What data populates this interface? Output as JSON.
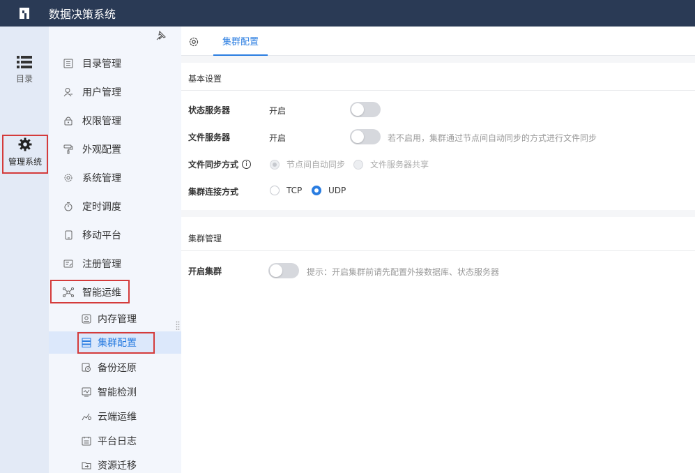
{
  "app": {
    "title": "数据决策系统"
  },
  "rail": {
    "directory_label": "目录",
    "admin_label": "管理系统"
  },
  "menu": {
    "items": [
      {
        "label": "目录管理",
        "icon": "list-doc-icon"
      },
      {
        "label": "用户管理",
        "icon": "user-icon"
      },
      {
        "label": "权限管理",
        "icon": "lock-icon"
      },
      {
        "label": "外观配置",
        "icon": "paint-roller-icon"
      },
      {
        "label": "系统管理",
        "icon": "gear-icon"
      },
      {
        "label": "定时调度",
        "icon": "stopwatch-icon"
      },
      {
        "label": "移动平台",
        "icon": "mobile-icon"
      },
      {
        "label": "注册管理",
        "icon": "register-icon"
      },
      {
        "label": "智能运维",
        "icon": "network-icon"
      }
    ],
    "sub_items": [
      {
        "label": "内存管理",
        "icon": "memory-icon"
      },
      {
        "label": "集群配置",
        "icon": "cluster-icon"
      },
      {
        "label": "备份还原",
        "icon": "backup-icon"
      },
      {
        "label": "智能检测",
        "icon": "monitor-icon"
      },
      {
        "label": "云端运维",
        "icon": "cloud-chart-icon"
      },
      {
        "label": "平台日志",
        "icon": "log-icon"
      },
      {
        "label": "资源迁移",
        "icon": "migrate-icon"
      }
    ],
    "active": "集群配置"
  },
  "tabs": {
    "active_label": "集群配置"
  },
  "basic": {
    "title": "基本设置",
    "state_server": {
      "label": "状态服务器",
      "value": "开启",
      "enabled": false
    },
    "file_server": {
      "label": "文件服务器",
      "value": "开启",
      "enabled": false,
      "hint": "若不启用，集群通过节点间自动同步的方式进行文件同步"
    },
    "file_sync": {
      "label": "文件同步方式",
      "options": [
        "节点间自动同步",
        "文件服务器共享"
      ],
      "selected": "节点间自动同步"
    },
    "cluster_conn": {
      "label": "集群连接方式",
      "options": [
        "TCP",
        "UDP"
      ],
      "selected": "UDP"
    }
  },
  "cluster": {
    "title": "集群管理",
    "enable": {
      "label": "开启集群",
      "enabled": false,
      "hint": "提示：开启集群前请先配置外接数据库、状态服务器"
    }
  },
  "colors": {
    "topbar": "#2a3a55",
    "accent": "#2a7de1",
    "highlight": "#d43b3b",
    "rail_bg": "#e3eaf6",
    "menu_bg": "#f3f6fc"
  }
}
